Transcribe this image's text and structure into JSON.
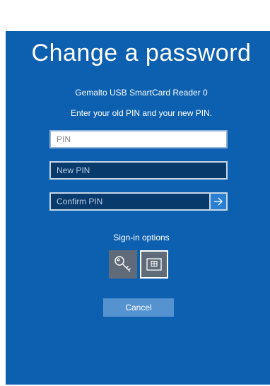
{
  "screen": {
    "title": "Change a password",
    "reader_name": "Gemalto USB SmartCard Reader 0",
    "instruction": "Enter your old PIN and your new PIN.",
    "fields": {
      "pin_placeholder": "PIN",
      "new_pin_placeholder": "New PIN",
      "confirm_pin_placeholder": "Confirm PIN"
    },
    "submit_icon": "arrow-right-icon",
    "sign_in_options": {
      "label": "Sign-in options",
      "options": [
        {
          "icon": "key-icon",
          "selected": false
        },
        {
          "icon": "smartcard-icon",
          "selected": true
        }
      ]
    },
    "cancel_label": "Cancel"
  },
  "colors": {
    "background": "#0d60b0",
    "field_dark": "#083a6b",
    "cancel_button": "#5593d0",
    "option_tile": "#5f6b78"
  }
}
